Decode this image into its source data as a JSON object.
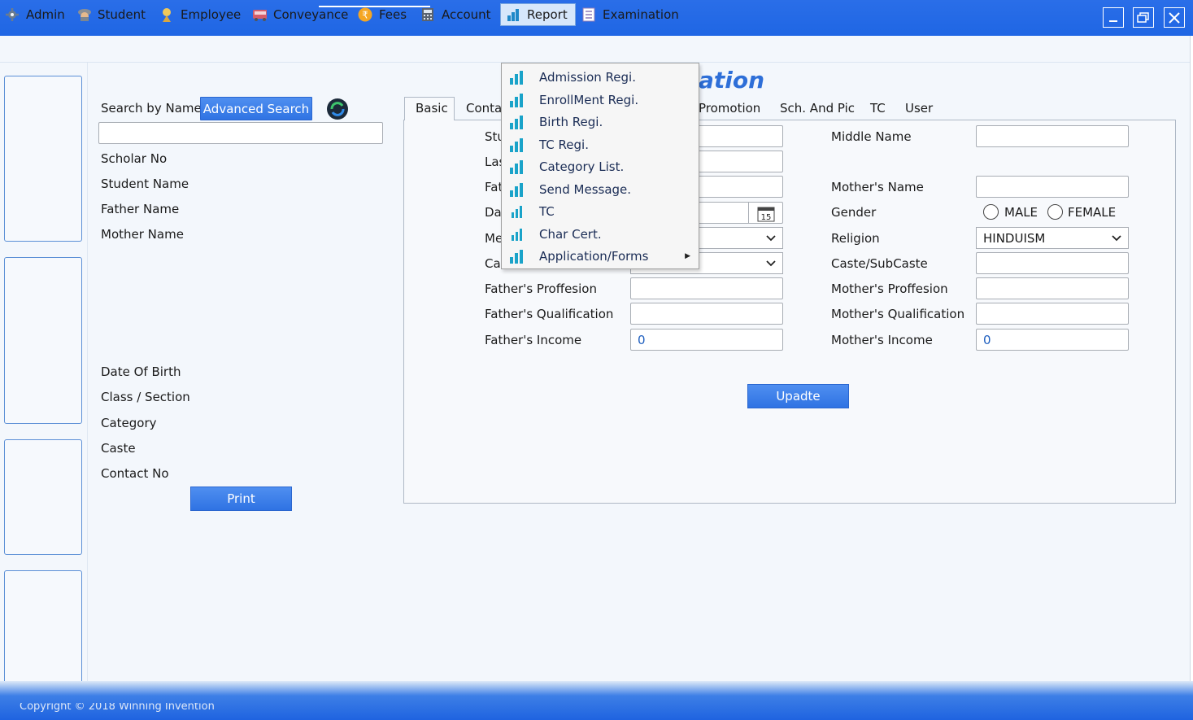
{
  "window": {
    "controls": [
      "minimize-icon",
      "restore-icon",
      "close-icon"
    ]
  },
  "menu": {
    "items": [
      {
        "label": "Admin",
        "icon": "gear-icon"
      },
      {
        "label": "Student",
        "icon": "student-icon"
      },
      {
        "label": "Employee",
        "icon": "employee-icon"
      },
      {
        "label": "Conveyance",
        "icon": "bus-icon"
      },
      {
        "label": "Fees",
        "icon": "rupee-icon"
      },
      {
        "label": "Account",
        "icon": "calculator-icon"
      },
      {
        "label": "Report",
        "icon": "bar-chart-icon",
        "active": true
      },
      {
        "label": "Examination",
        "icon": "list-icon"
      }
    ]
  },
  "report_menu": {
    "items": [
      {
        "label": "Admission Regi."
      },
      {
        "label": "EnrollMent Regi."
      },
      {
        "label": "Birth Regi."
      },
      {
        "label": "TC Regi."
      },
      {
        "label": "Category List."
      },
      {
        "label": "Send Message."
      },
      {
        "label": "TC"
      },
      {
        "label": "Char Cert."
      },
      {
        "label": "Application/Forms",
        "has_submenu": true
      }
    ]
  },
  "search": {
    "label": "Search by Name",
    "advanced_button": "Advanced Search",
    "input_value": "",
    "refresh_icon": "refresh-icon"
  },
  "details": {
    "scholar_no": "Scholar No",
    "student_name": "Student Name",
    "father_name": "Father Name",
    "mother_name": "Mother Name",
    "dob": "Date Of Birth",
    "class_section": "Class / Section",
    "category": "Category",
    "caste": "Caste",
    "contact_no": "Contact No",
    "print_button": "Print"
  },
  "heading": {
    "visible_text": "ation"
  },
  "tabs": [
    "Basic",
    "Conta",
    "Promotion",
    "Sch. And Pic",
    "TC",
    "User"
  ],
  "form": {
    "left_labels_partial": [
      "Stu",
      "Las",
      "Fat",
      "Da",
      "Me",
      "Ca"
    ],
    "fathers_profession": "Father's Proffesion",
    "fathers_qualification": "Father's Qualification",
    "fathers_income": "Father's Income",
    "fathers_income_value": "0",
    "middle_name": "Middle Name",
    "mothers_name": "Mother's Name",
    "gender": "Gender",
    "gender_male": "MALE",
    "gender_female": "FEMALE",
    "religion": "Religion",
    "religion_value": "HINDUISM",
    "caste_subcaste": "Caste/SubCaste",
    "mothers_profession": "Mother's Proffesion",
    "mothers_qualification": "Mother's Qualification",
    "mothers_income": "Mother's Income",
    "mothers_income_value": "0",
    "calendar_day": "15",
    "update_button": "Upadte"
  },
  "footer": {
    "text": "Copyright © 2018 Winning Invention"
  },
  "colors": {
    "titlebar": "#1f66e4",
    "accent": "#2e6fd8",
    "button": "#2f73e3"
  }
}
